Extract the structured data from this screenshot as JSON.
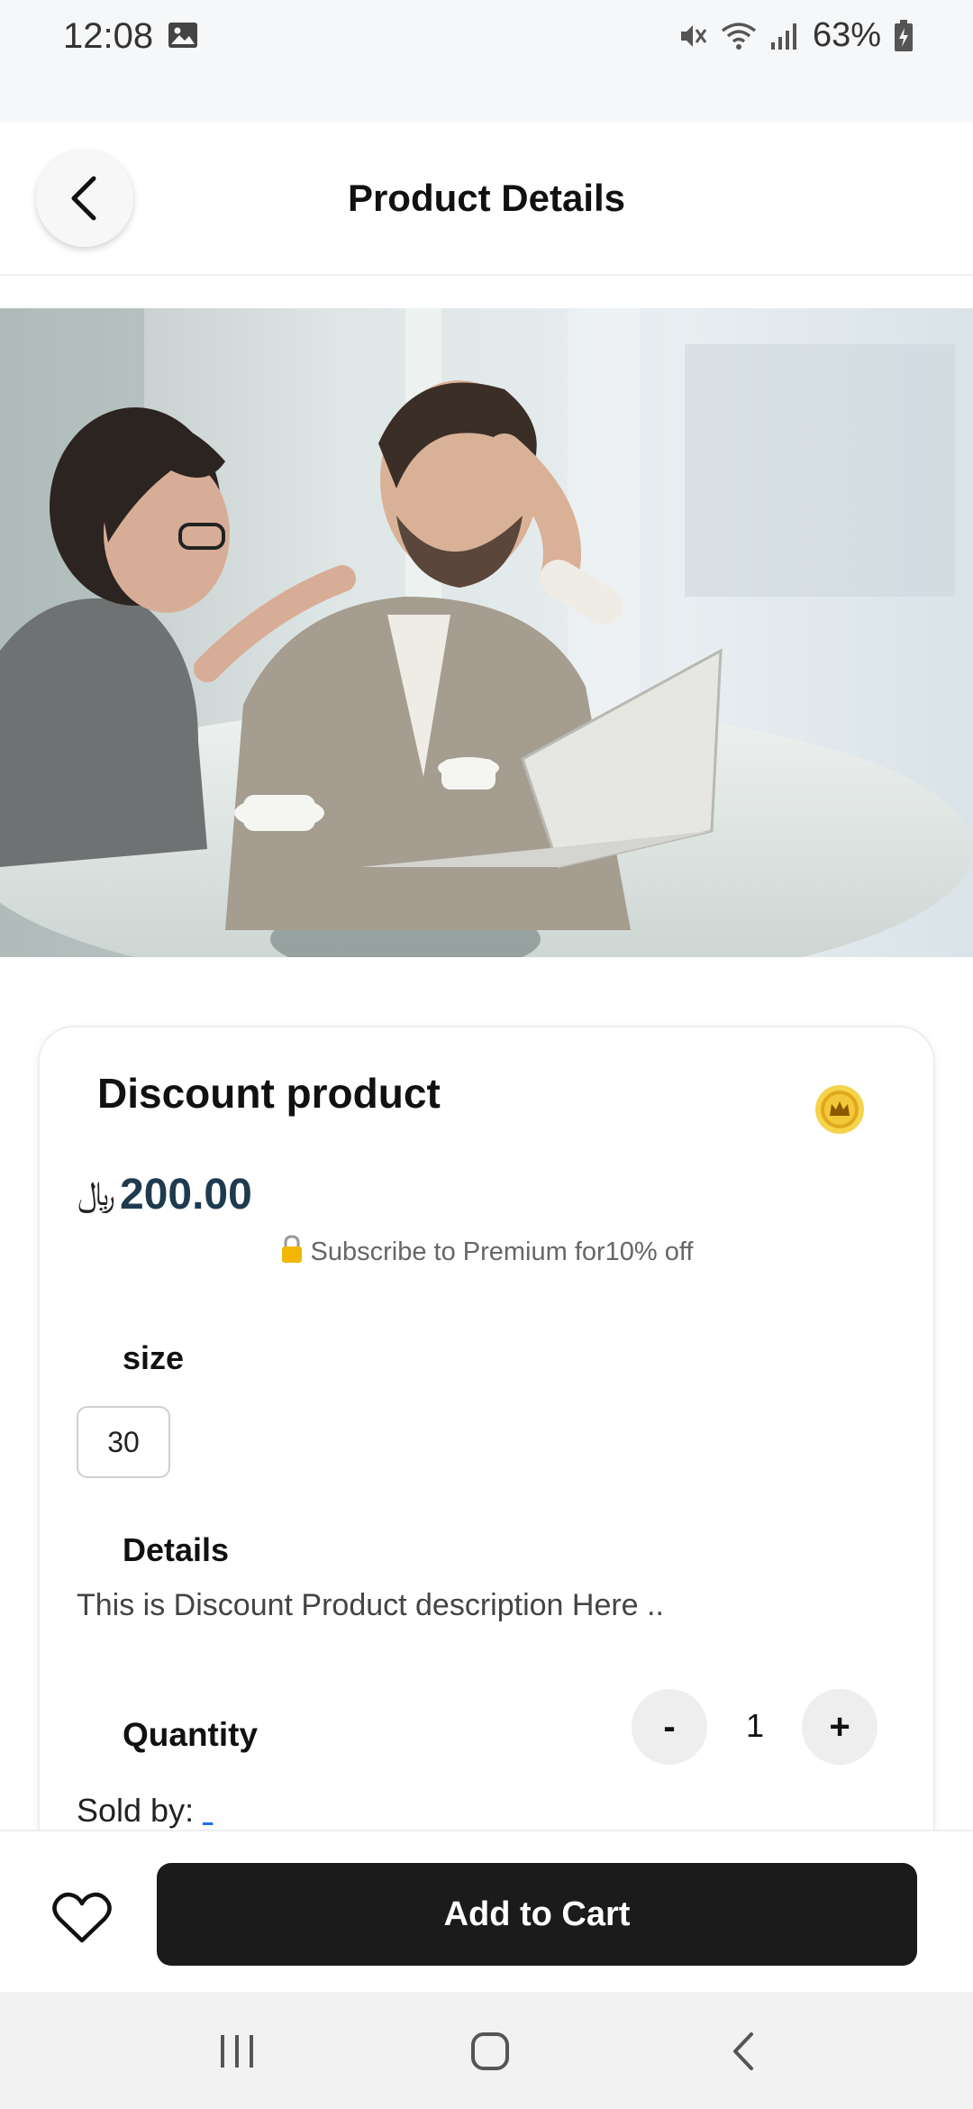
{
  "status_bar": {
    "time": "12:08",
    "battery_percent": "63%",
    "icons": [
      "image-icon",
      "mute-icon",
      "wifi-icon",
      "signal-icon",
      "battery-icon"
    ]
  },
  "header": {
    "title": "Product Details",
    "back_icon": "chevron-left-icon"
  },
  "product": {
    "name": "Discount product",
    "currency_symbol": "﷼",
    "price": "200.00",
    "premium_note": "Subscribe to Premium for10% off",
    "size_label": "size",
    "sizes": [
      "30"
    ],
    "details_label": "Details",
    "description": "This is Discount Product description Here ..",
    "quantity_label": "Quantity",
    "quantity_minus": "-",
    "quantity_value": "1",
    "quantity_plus": "+",
    "sold_by_label": "Sold by:",
    "seller": "_"
  },
  "actions": {
    "add_to_cart": "Add to Cart",
    "wishlist_icon": "heart-icon"
  },
  "colors": {
    "price": "#1e3a4f",
    "cart_button": "#1b1b1b",
    "badge_gold": "#e0a81c"
  }
}
